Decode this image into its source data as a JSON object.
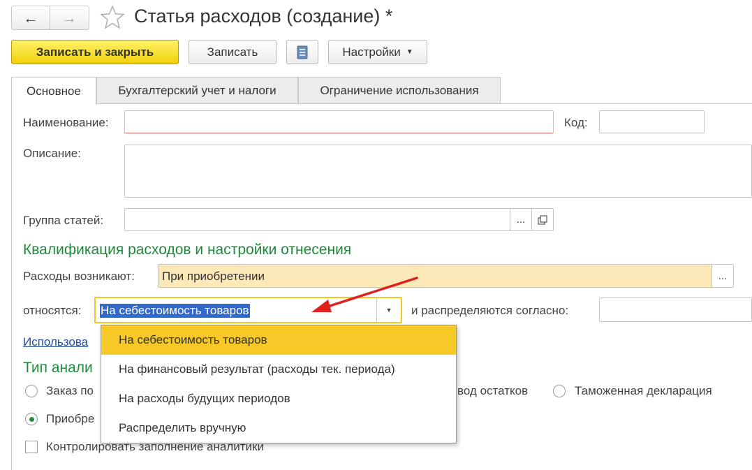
{
  "window": {
    "title": "Статья расходов (создание) *"
  },
  "nav": {
    "back_icon": "arrow-left-icon",
    "forward_icon": "arrow-right-icon",
    "favorite_icon": "star-icon"
  },
  "toolbar": {
    "save_close_label": "Записать и закрыть",
    "save_label": "Записать",
    "report_icon": "list-icon",
    "settings_label": "Настройки"
  },
  "tabs": [
    {
      "label": "Основное",
      "active": true
    },
    {
      "label": "Бухгалтерский учет и налоги",
      "active": false
    },
    {
      "label": "Ограничение использования",
      "active": false
    }
  ],
  "form": {
    "name_label": "Наименование:",
    "name_value": "",
    "code_label": "Код:",
    "code_value": "",
    "description_label": "Описание:",
    "description_value": "",
    "group_label": "Группа статей:",
    "group_value": "",
    "group_select_label": "...",
    "group_open_icon": "open-icon",
    "section_title": "Квалификация расходов и настройки отнесения",
    "arises_label": "Расходы возникают:",
    "arises_value": "При приобретении",
    "arises_select_label": "...",
    "relates_label": "относятся:",
    "relates_value": "На себестоимость товаров",
    "distributed_label": "и распределяются согласно:",
    "distributed_value": "",
    "usage_link": "Использова",
    "analytics_title": "Тип анали",
    "radio_order": "Заказ по",
    "radio_input": "вод остатков",
    "radio_customs": "Таможенная декларация",
    "radio_purchase": "Приобре",
    "check_control": "Контролировать заполнение аналитики"
  },
  "dropdown": {
    "items": [
      "На себестоимость товаров",
      "На финансовый результат (расходы тек. периода)",
      "На расходы будущих периодов",
      "Распределить вручную"
    ],
    "selected_index": 0
  },
  "colors": {
    "primary_button": "#f2d00a",
    "section_green": "#1d8a3a",
    "dropdown_selected": "#f7c928",
    "highlight_field": "#fde8b8",
    "arrow_red": "#e02020"
  }
}
